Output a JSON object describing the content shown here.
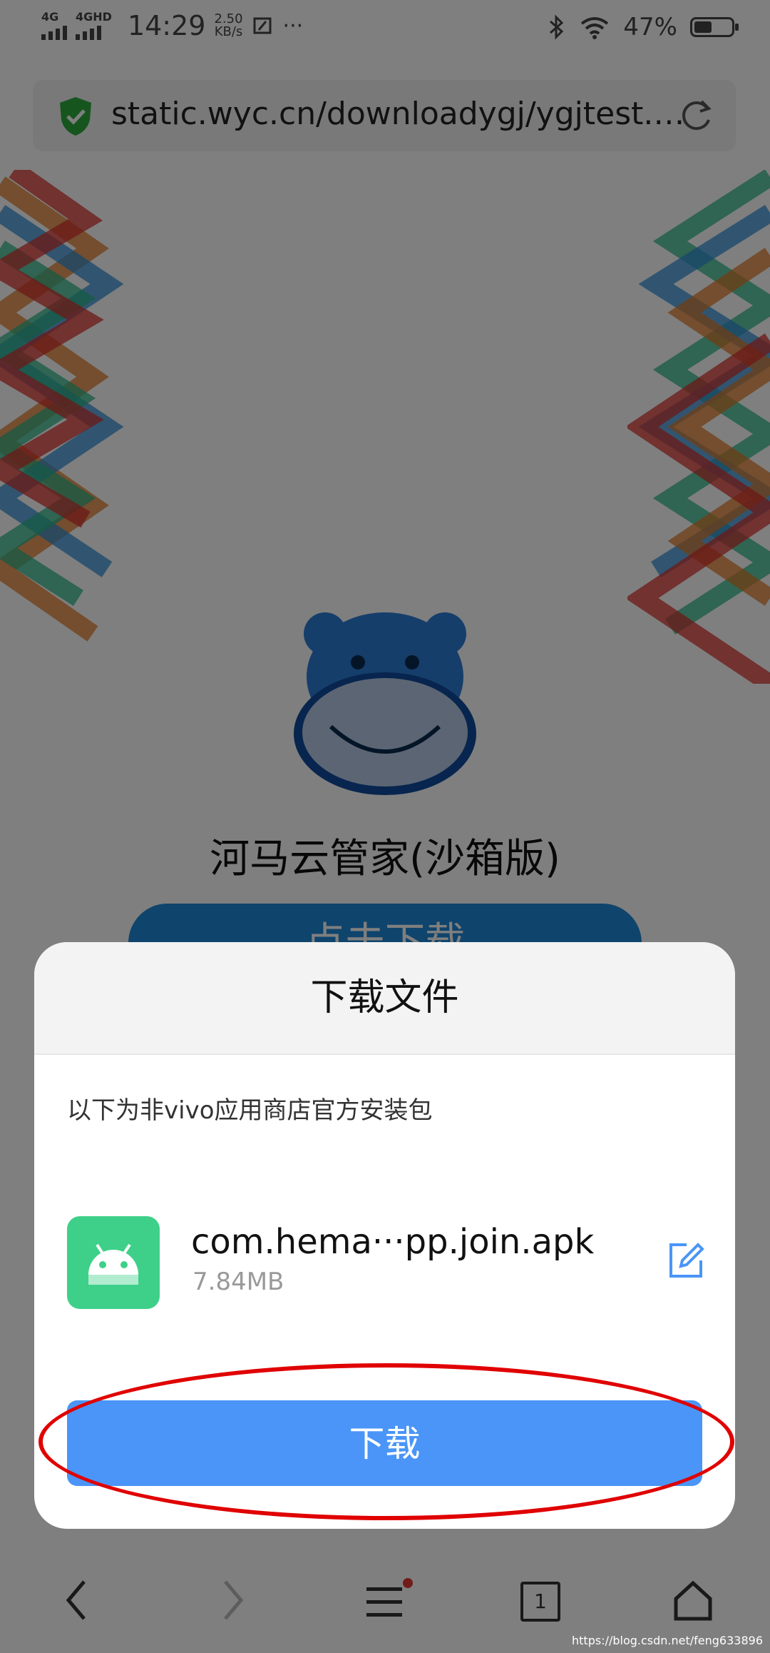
{
  "status_bar": {
    "net1": "4G",
    "net2": "4GHD",
    "time": "14:29",
    "speed_value": "2.50",
    "speed_unit": "KB/s",
    "more": "···",
    "battery_text": "47%",
    "battery_level": 0.47
  },
  "url_bar": {
    "url": "static.wyc.cn/downloadygj/ygjtest.…"
  },
  "page": {
    "app_title": "河马云管家(沙箱版)",
    "download_button": "点击下载"
  },
  "dialog": {
    "title": "下载文件",
    "note": "以下为非vivo应用商店官方安装包",
    "file_name": "com.hema···pp.join.apk",
    "file_size": "7.84MB",
    "download_button": "下载"
  },
  "bottom_bar": {
    "tabs_count": "1"
  },
  "watermark": "https://blog.csdn.net/feng633896",
  "colors": {
    "accent": "#4a95f7",
    "highlight": "#e00000",
    "apk_icon": "#3ed089"
  }
}
